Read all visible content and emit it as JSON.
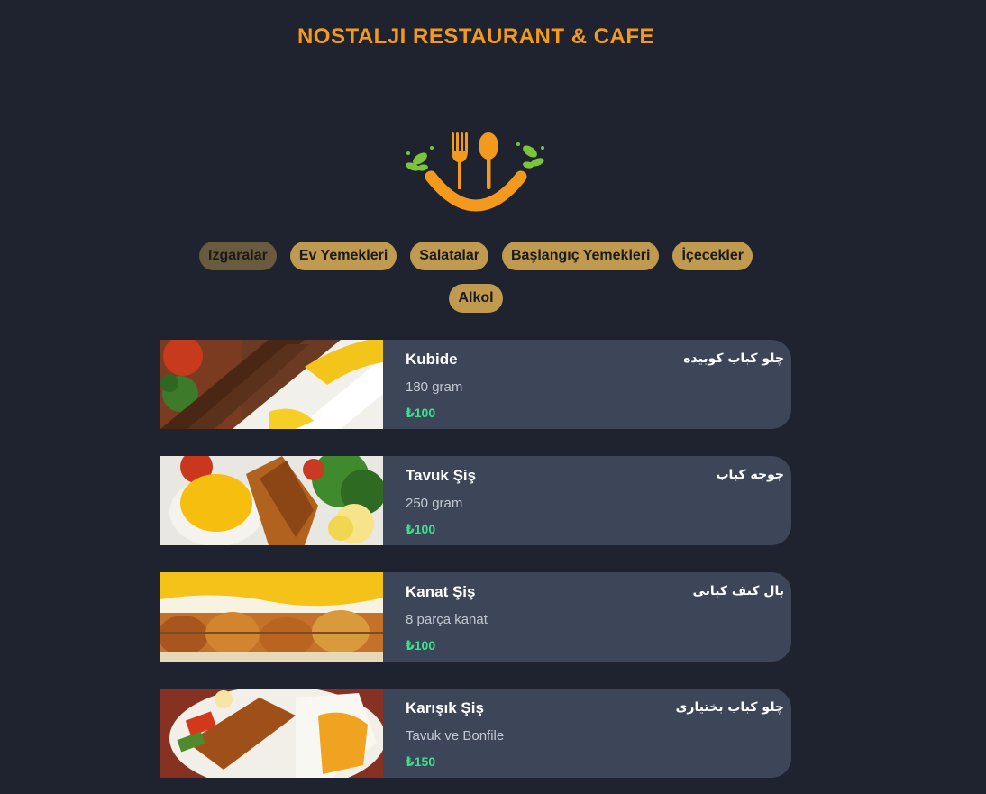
{
  "header": {
    "title": "NOSTALJI RESTAURANT & CAFE"
  },
  "logo": {
    "icon": "fork-spoon-smile-logo",
    "colors": {
      "orange": "#f39a1e",
      "leaf": "#7cc43a"
    }
  },
  "tabs": [
    {
      "label": "Izgaralar",
      "active": true
    },
    {
      "label": "Ev Yemekleri",
      "active": false
    },
    {
      "label": "Salatalar",
      "active": false
    },
    {
      "label": "Başlangıç Yemekleri",
      "active": false
    },
    {
      "label": "İçecekler",
      "active": false
    },
    {
      "label": "Alkol",
      "active": false
    }
  ],
  "menu": {
    "items": [
      {
        "name": "Kubide",
        "alt_name": "چلو کباب کوبیده",
        "desc": "180 gram",
        "price": "₺100"
      },
      {
        "name": "Tavuk Şiş",
        "alt_name": "جوجه کباب",
        "desc": "250 gram",
        "price": "₺100"
      },
      {
        "name": "Kanat Şiş",
        "alt_name": "بال کتف کبابی",
        "desc": "8 parça kanat",
        "price": "₺100"
      },
      {
        "name": "Karışık Şiş",
        "alt_name": "چلو کباب بختیاری",
        "desc": "Tavuk ve Bonfile",
        "price": "₺150"
      }
    ]
  },
  "colors": {
    "background": "#1f2330",
    "card": "#3d4659",
    "accent": "#f39a1e",
    "tab": "#c09a4f",
    "tab_active": "#6a5a3e",
    "price": "#3de08a"
  }
}
